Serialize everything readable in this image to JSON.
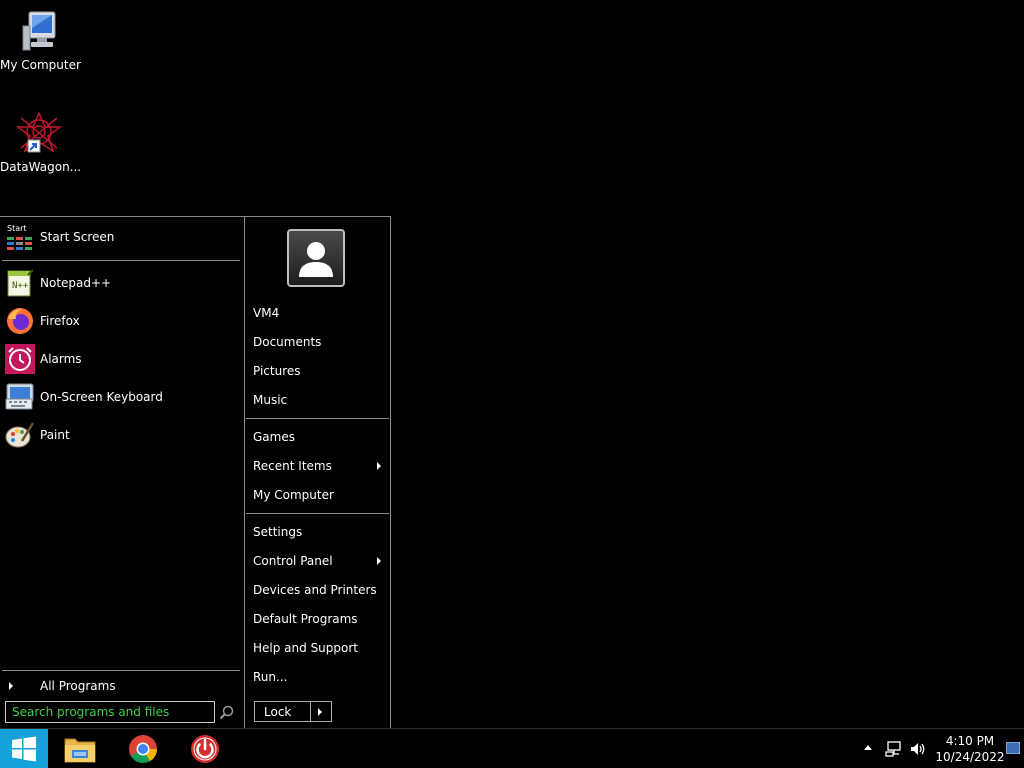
{
  "desktop": {
    "icons": [
      {
        "label": "My Computer",
        "icon": "computer-icon"
      },
      {
        "label": "DataWagon...",
        "icon": "datawagon-icon"
      }
    ]
  },
  "start_menu": {
    "pinned": {
      "label": "Start Screen",
      "badge": "Start",
      "icon": "start-screen-icon"
    },
    "recent": [
      {
        "label": "Notepad++",
        "icon": "notepadpp-icon"
      },
      {
        "label": "Firefox",
        "icon": "firefox-icon"
      },
      {
        "label": "Alarms",
        "icon": "alarm-clock-icon"
      },
      {
        "label": "On-Screen Keyboard",
        "icon": "keyboard-icon"
      },
      {
        "label": "Paint",
        "icon": "paint-palette-icon"
      }
    ],
    "all_programs": "All Programs",
    "search": {
      "placeholder": "Search programs and files",
      "value": ""
    },
    "right": {
      "user": "VM4",
      "group1": [
        "Documents",
        "Pictures",
        "Music"
      ],
      "group2": [
        {
          "label": "Games",
          "submenu": false
        },
        {
          "label": "Recent Items",
          "submenu": true
        },
        {
          "label": "My Computer",
          "submenu": false
        }
      ],
      "group3": [
        {
          "label": "Settings",
          "submenu": false
        },
        {
          "label": "Control Panel",
          "submenu": true
        },
        {
          "label": "Devices and Printers",
          "submenu": false
        },
        {
          "label": "Default Programs",
          "submenu": false
        },
        {
          "label": "Help and Support",
          "submenu": false
        },
        {
          "label": "Run...",
          "submenu": false
        }
      ]
    },
    "lock": "Lock"
  },
  "taskbar": {
    "apps": [
      "file-explorer-icon",
      "chrome-icon",
      "power-app-icon"
    ],
    "clock": {
      "time": "4:10 PM",
      "date": "10/24/2022"
    }
  },
  "colors": {
    "accent": "#15a2d8",
    "search_text": "#2ecc40"
  }
}
